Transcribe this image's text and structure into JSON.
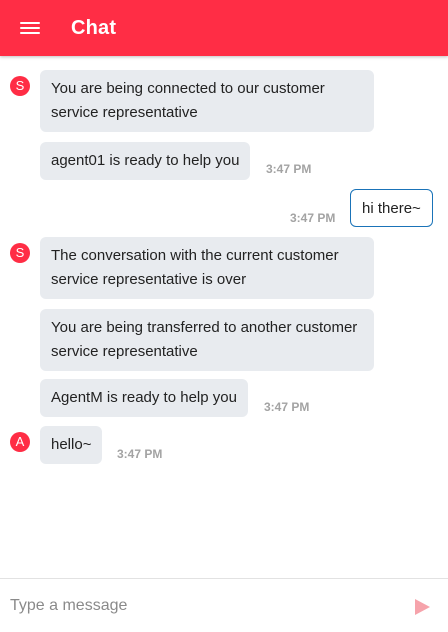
{
  "header": {
    "title": "Chat",
    "menu_icon": "menu-icon",
    "color": "#ff2d45"
  },
  "messages": [
    {
      "sender": "S",
      "text": "You are being connected to our customer service representative",
      "time": ""
    },
    {
      "sender": "S",
      "text": "agent01 is ready to help you",
      "time": "3:47 PM"
    },
    {
      "sender": "me",
      "text": "hi there~",
      "time": "3:47 PM"
    },
    {
      "sender": "S",
      "text": "The conversation with the current customer service representative is over",
      "time": ""
    },
    {
      "sender": "S",
      "text": "You are being transferred to another customer service representative",
      "time": ""
    },
    {
      "sender": "S",
      "text": "AgentM is ready to help you",
      "time": "3:47 PM"
    },
    {
      "sender": "A",
      "text": "hello~",
      "time": "3:47 PM"
    }
  ],
  "composer": {
    "placeholder": "Type a message",
    "send_icon": "send-icon"
  }
}
